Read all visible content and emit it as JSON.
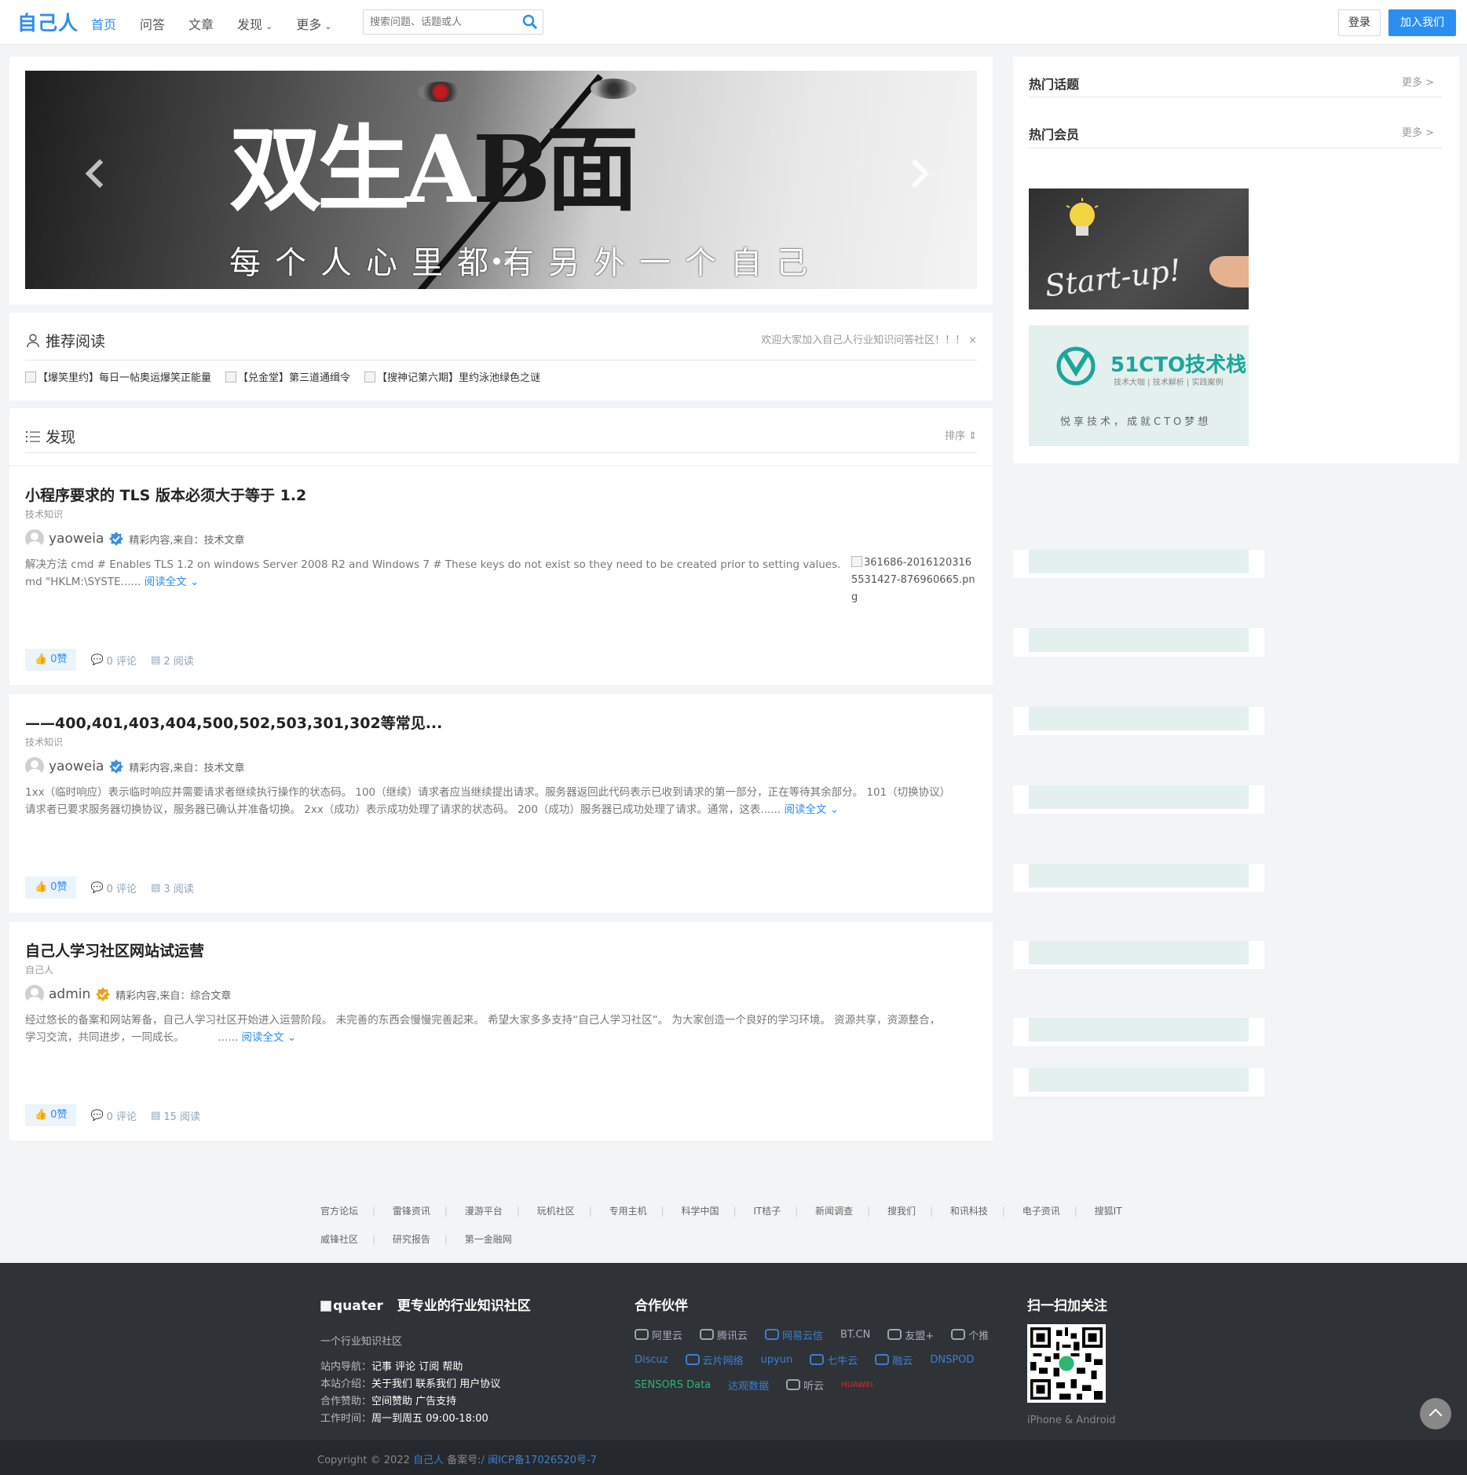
{
  "header": {
    "logo": "自己人",
    "nav": [
      {
        "label": "首页",
        "active": true
      },
      {
        "label": "问答"
      },
      {
        "label": "文章"
      },
      {
        "label": "发现",
        "dropdown": true
      },
      {
        "label": "更多",
        "dropdown": true
      }
    ],
    "search_placeholder": "搜索问题、话题或人",
    "login": "登录",
    "join": "加入我们"
  },
  "banner": {
    "headline_a": "双生A",
    "headline_b": "B面",
    "subtitle": "每个人心里都有另外一个自己"
  },
  "recommend": {
    "title": "推荐阅读",
    "notice": "欢迎大家加入自己人行业知识问答社区！！！",
    "close": "×",
    "links": [
      "【爆笑里约】每日一帖奥运爆笑正能量",
      "【兑金堂】第三道通缉令",
      "【搜神记第六期】里约泳池绿色之谜"
    ]
  },
  "discover": {
    "title": "发现",
    "sort": "排序"
  },
  "posts": [
    {
      "title": "小程序要求的 TLS 版本必须大于等于 1.2",
      "category": "技术知识",
      "author": "yaoweia",
      "source": "精彩内容,来自：技术文章",
      "excerpt_1": "解决方法   cmd   # Enables TLS 1.2 on windows Server 2008 R2 and Windows 7 # These keys do not exist so they need to be created prior to setting values.",
      "excerpt_2": "md \"HKLM:\\SYSTE......",
      "read_more": "阅读全文",
      "image_alt": "361686-20161203165531427-876960665.png",
      "likes": "0赞",
      "comments": "0 评论",
      "views": "2 阅读"
    },
    {
      "title": "——400,401,403,404,500,502,503,301,302等常见...",
      "category": "技术知识",
      "author": "yaoweia",
      "source": "精彩内容,来自：技术文章",
      "excerpt_1": "1xx（临时响应）表示临时响应并需要请求者继续执行操作的状态码。 100（继续）请求者应当继续提出请求。服务器返回此代码表示已收到请求的第一部分，正在等待其余部分。 101（切换协议）",
      "excerpt_2": "请求者已要求服务器切换协议，服务器已确认并准备切换。 2xx（成功）表示成功处理了请求的状态码。 200（成功）服务器已成功处理了请求。通常，这表......",
      "read_more": "阅读全文",
      "likes": "0赞",
      "comments": "0 评论",
      "views": "3 阅读"
    },
    {
      "title": "自己人学习社区网站试运营",
      "category": "自己人",
      "author": "admin",
      "source": "精彩内容,来自：综合文章",
      "excerpt_1": "经过悠长的备案和网站筹备，自己人学习社区开始进入运营阶段。 未完善的东西会慢慢完善起来。 希望大家多多支持“自己人学习社区”。 为大家创造一个良好的学习环境。 资源共享，资源整合，",
      "excerpt_2": "学习交流，共同进步，一同成长。          ......",
      "read_more": "阅读全文",
      "likes": "0赞",
      "comments": "0 评论",
      "views": "15 阅读"
    }
  ],
  "sidebar": {
    "hot_topics": "热门话题",
    "hot_members": "热门会员",
    "more": "更多 >",
    "ad1_text": "Start-up!",
    "ad2_logo": "51CTO技术栈",
    "ad2_sub": "技术大咖 | 技术解析 | 实践案例",
    "ad2_slogan": "悦享技术，成就CTO梦想"
  },
  "footer_links": {
    "row1": [
      "官方论坛",
      "雷锋资讯",
      "漫游平台",
      "玩机社区",
      "专用主机",
      "科学中国",
      "IT桔子",
      "新闻调查",
      "搜我们",
      "和讯科技",
      "电子资讯",
      "搜狐IT"
    ],
    "row2": [
      "威锋社区",
      "研究报告",
      "第一金融网"
    ]
  },
  "footer": {
    "brand_img_alt": "quater",
    "brand_title": "更专业的行业知识社区",
    "tagline": "一个行业知识社区",
    "nav_label": "站内导航：",
    "nav_links": "记事 评论 订阅 帮助",
    "about_label": "本站介绍：",
    "about_links": "关于我们 联系我们 用户协议",
    "sponsor_label": "合作赞助：",
    "sponsor_links": "空间赞助 广告支持",
    "hours_label": "工作时间：",
    "hours": "周一到周五 09:00-18:00",
    "partners_title": "合作伙伴",
    "partners": [
      "阿里云",
      "腾讯云",
      "网易云信",
      "BT.CN",
      "友盟+",
      "个推",
      "Discuz",
      "云片网络",
      "upyun",
      "七牛云",
      "融云",
      "DNSPOD",
      "SENSORS Data",
      "达观数据",
      "听云",
      "HUAWEI"
    ],
    "qr_title": "扫一扫加关注",
    "qr_caption": "iPhone & Android",
    "copyright_prefix": "Copyright © 2022",
    "copyright_site": "自己人",
    "icp_label": "备案号:",
    "icp": "/ 闽ICP备17026520号-7"
  }
}
